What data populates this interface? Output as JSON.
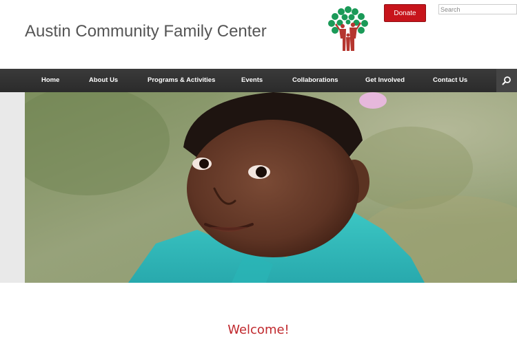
{
  "header": {
    "site_title": "Austin Community Family Center",
    "logo_icon": "tree-family-logo-icon",
    "donate_label": "Donate",
    "search_placeholder": "Search"
  },
  "nav": {
    "items": [
      {
        "label": "Home"
      },
      {
        "label": "About Us"
      },
      {
        "label": "Programs & Activities"
      },
      {
        "label": "Events"
      },
      {
        "label": "Collaborations"
      },
      {
        "label": "Get Involved"
      },
      {
        "label": "Contact Us"
      }
    ],
    "search_icon": "search-icon"
  },
  "hero": {
    "image": "smiling-child-photo"
  },
  "content": {
    "heading": "Welcome!"
  },
  "colors": {
    "accent": "#c7141b",
    "nav_background": "#333333",
    "heading": "#c0282d",
    "logo_green": "#1b9a58",
    "logo_red": "#b5362f"
  }
}
